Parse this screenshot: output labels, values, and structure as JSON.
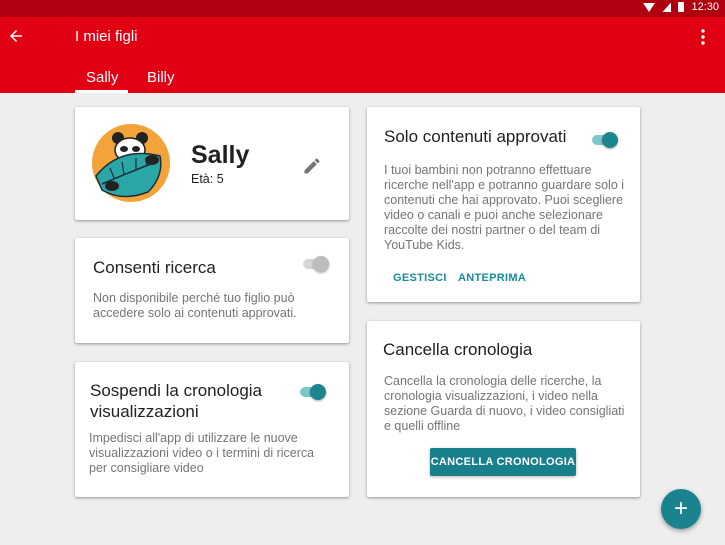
{
  "status_bar": {
    "time": "12:30"
  },
  "app_bar": {
    "title": "I miei figli"
  },
  "tabs": [
    {
      "label": "Sally",
      "selected": true
    },
    {
      "label": "Billy",
      "selected": false
    }
  ],
  "profile": {
    "name": "Sally",
    "age": "Età: 5"
  },
  "allow_search": {
    "title": "Consenti ricerca",
    "description": "Non disponibile perché tuo figlio può accedere solo ai contenuti approvati.",
    "enabled": false
  },
  "pause_history": {
    "title": "Sospendi la cronologia visualizzazioni",
    "description": "Impedisci all'app di utilizzare le nuove visualizzazioni video o i termini di ricerca per consigliare video",
    "enabled": true
  },
  "approved_only": {
    "title": "Solo contenuti approvati",
    "description": "I tuoi bambini non potranno effettuare ricerche nell'app e potranno guardare solo i contenuti che hai approvato. Puoi scegliere video o canali e puoi anche selezionare raccolte dei nostri partner o del team di YouTube Kids.",
    "enabled": true,
    "manage_label": "GESTISCI",
    "preview_label": "ANTEPRIMA"
  },
  "clear_history": {
    "title": "Cancella cronologia",
    "description": "Cancella la cronologia delle ricerche, la cronologia visualizzazioni, i video nella sezione Guarda di nuovo, i video consigliati e quelli offline",
    "button_label": "CANCELLA CRONOLOGIA"
  },
  "fab": {
    "label": "+"
  },
  "colors": {
    "app_bar": "#e10013",
    "status_bar": "#b0000f",
    "accent": "#1a838e"
  }
}
